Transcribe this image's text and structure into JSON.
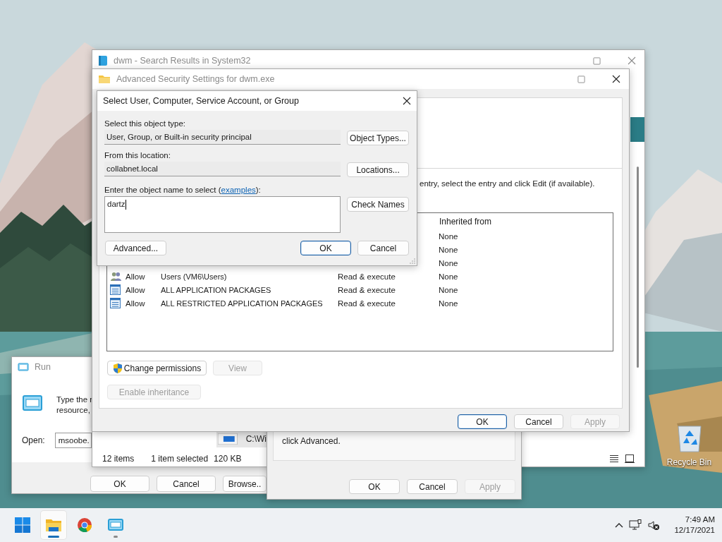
{
  "explorer": {
    "title": "dwm - Search Results in System32",
    "item_fragment": "C:\\Wi",
    "status_items": [
      "12 items",
      "1 item selected",
      "120 KB"
    ]
  },
  "run_dialog": {
    "title": "Run",
    "description_lines": [
      "Type the r",
      "resource,"
    ],
    "open_label": "Open:",
    "open_value": "msoobe.",
    "buttons": [
      {
        "label": "OK",
        "disabled": false,
        "default": false
      },
      {
        "label": "Cancel",
        "disabled": false,
        "default": false
      },
      {
        "label": "Browse..",
        "disabled": false,
        "default": false
      }
    ]
  },
  "properties_dialog": {
    "text": "click Advanced.",
    "buttons": [
      {
        "label": "OK",
        "disabled": false,
        "default": false
      },
      {
        "label": "Cancel",
        "disabled": false,
        "default": false
      },
      {
        "label": "Apply",
        "disabled": true,
        "default": false
      }
    ]
  },
  "advanced_security": {
    "title": "Advanced Security Settings for dwm.exe",
    "hint": "entry, select the entry and click Edit (if available).",
    "column_header": "Inherited from",
    "rows": [
      {
        "kind": "covered",
        "inherited_from": "None"
      },
      {
        "kind": "covered",
        "inherited_from": "None"
      },
      {
        "kind": "covered",
        "inherited_from": "None"
      },
      {
        "kind": "users",
        "type": "Allow",
        "principal": "Users (VM6\\Users)",
        "access": "Read & execute",
        "inherited_from": "None"
      },
      {
        "kind": "package",
        "type": "Allow",
        "principal": "ALL APPLICATION PACKAGES",
        "access": "Read & execute",
        "inherited_from": "None"
      },
      {
        "kind": "package",
        "type": "Allow",
        "principal": "ALL RESTRICTED APPLICATION PACKAGES",
        "access": "Read & execute",
        "inherited_from": "None"
      }
    ],
    "actions": [
      {
        "label": "Change permissions",
        "disabled": false,
        "default": false
      },
      {
        "label": "View",
        "disabled": true,
        "default": false
      },
      {
        "label": "Enable inheritance",
        "disabled": true,
        "default": false
      }
    ],
    "buttons": [
      {
        "label": "OK",
        "disabled": false,
        "default": true
      },
      {
        "label": "Cancel",
        "disabled": false,
        "default": false
      },
      {
        "label": "Apply",
        "disabled": true,
        "default": false
      }
    ]
  },
  "select_dialog": {
    "title": "Select User, Computer, Service Account, or Group",
    "object_type_label": "Select this object type:",
    "object_type_value": "User, Group, or Built-in security principal",
    "object_types_button": "Object Types...",
    "location_label": "From this location:",
    "location_value": "collabnet.local",
    "locations_button": "Locations...",
    "name_label": {
      "before": "Enter the object name to select (",
      "link": "examples",
      "after": "):"
    },
    "name_value": "dartz",
    "check_names_button": "Check Names",
    "buttons": [
      {
        "label": "Advanced...",
        "disabled": false,
        "default": false
      },
      {
        "label": "OK",
        "disabled": false,
        "default": true
      },
      {
        "label": "Cancel",
        "disabled": false,
        "default": false
      }
    ]
  },
  "desktop": {
    "icons": [
      {
        "label": "Recycle Bin"
      }
    ]
  },
  "taskbar": {
    "apps": [
      {
        "kind": "start",
        "selected": false,
        "running": false
      },
      {
        "kind": "explorer",
        "selected": true,
        "running": true
      },
      {
        "kind": "chrome",
        "selected": false,
        "running": false
      },
      {
        "kind": "run",
        "selected": false,
        "running": true
      }
    ],
    "time": "7:49 AM",
    "date": "12/17/2021"
  }
}
